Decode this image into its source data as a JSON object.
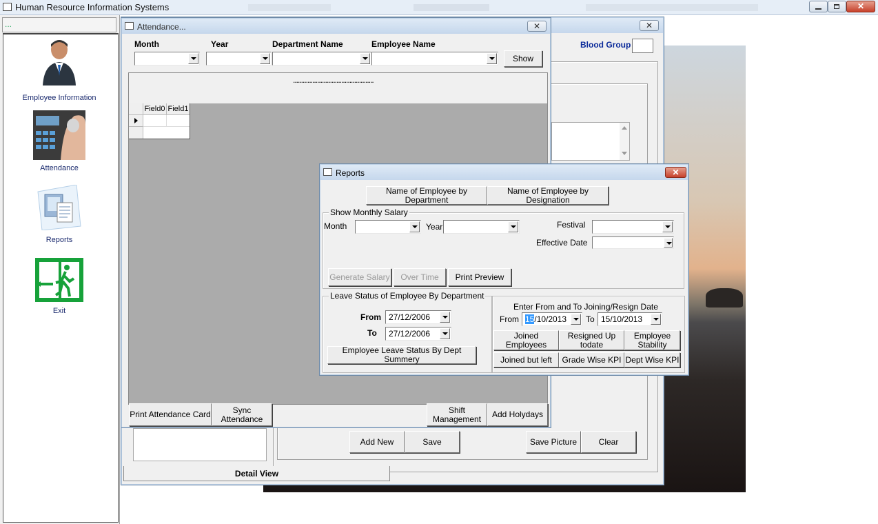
{
  "app": {
    "title": "Human Resource Information Systems"
  },
  "sidebar": {
    "header": "...",
    "items": [
      {
        "label": "Employee Information",
        "icon": "employee-icon"
      },
      {
        "label": "Attendance",
        "icon": "fingerprint-terminal-icon"
      },
      {
        "label": "Reports",
        "icon": "reports-icon"
      },
      {
        "label": "Exit",
        "icon": "exit-door-icon"
      }
    ]
  },
  "employee_window": {
    "blood_group_label": "Blood Group",
    "blood_group_value": "",
    "buttons": {
      "add_new": "Add New",
      "save": "Save",
      "save_picture": "Save Picture",
      "clear": "Clear"
    },
    "tab_label": "Detail View"
  },
  "attendance": {
    "title": "Attendance...",
    "filters": {
      "month_label": "Month",
      "month_value": "",
      "year_label": "Year",
      "year_value": "",
      "department_label": "Department Name",
      "department_value": "",
      "employee_label": "Employee Name",
      "employee_value": ""
    },
    "show_button": "Show",
    "grid_caption": "..................................................",
    "grid_columns": [
      "Field0",
      "Field1"
    ],
    "buttons": {
      "print_card": "Print Attendance Card",
      "sync_line1": "Sync",
      "sync_line2": "Attendance",
      "shift_line1": "Shift",
      "shift_line2": "Management",
      "add_holydays": "Add Holydays"
    }
  },
  "reports": {
    "title": "Reports",
    "top_buttons": {
      "by_department": "Name of Employee by Department",
      "by_designation": "Name of Employee by Designation"
    },
    "salary": {
      "legend": "Show Monthly Salary",
      "month_label": "Month",
      "month_value": "",
      "year_label": "Year",
      "year_value": "",
      "festival_label": "Festival",
      "festival_value": "",
      "effective_label": "Effective Date",
      "effective_value": "",
      "buttons": {
        "generate": "Generate Salary",
        "over_time": "Over Time",
        "print_preview": "Print Preview"
      }
    },
    "leave": {
      "legend": "Leave Status of Employee By Department",
      "from_label": "From",
      "from_value": "27/12/2006",
      "to_label": "To",
      "to_value": "27/12/2006",
      "summary_button": "Employee Leave Status By Dept Summery"
    },
    "joining": {
      "heading": "Enter From and To Joining/Resign Date",
      "from_label": "From",
      "from_selected": "15",
      "from_rest": "/10/2013",
      "to_label": "To",
      "to_value": "15/10/2013",
      "buttons": {
        "joined": "Joined Employees",
        "resigned_l1": "Resigned Up",
        "resigned_l2": "todate",
        "stability_l1": "Employee",
        "stability_l2": "Stability",
        "joined_left": "Joined but left",
        "grade_kpi": "Grade Wise KPI",
        "dept_kpi": "Dept Wise KPI"
      }
    }
  }
}
